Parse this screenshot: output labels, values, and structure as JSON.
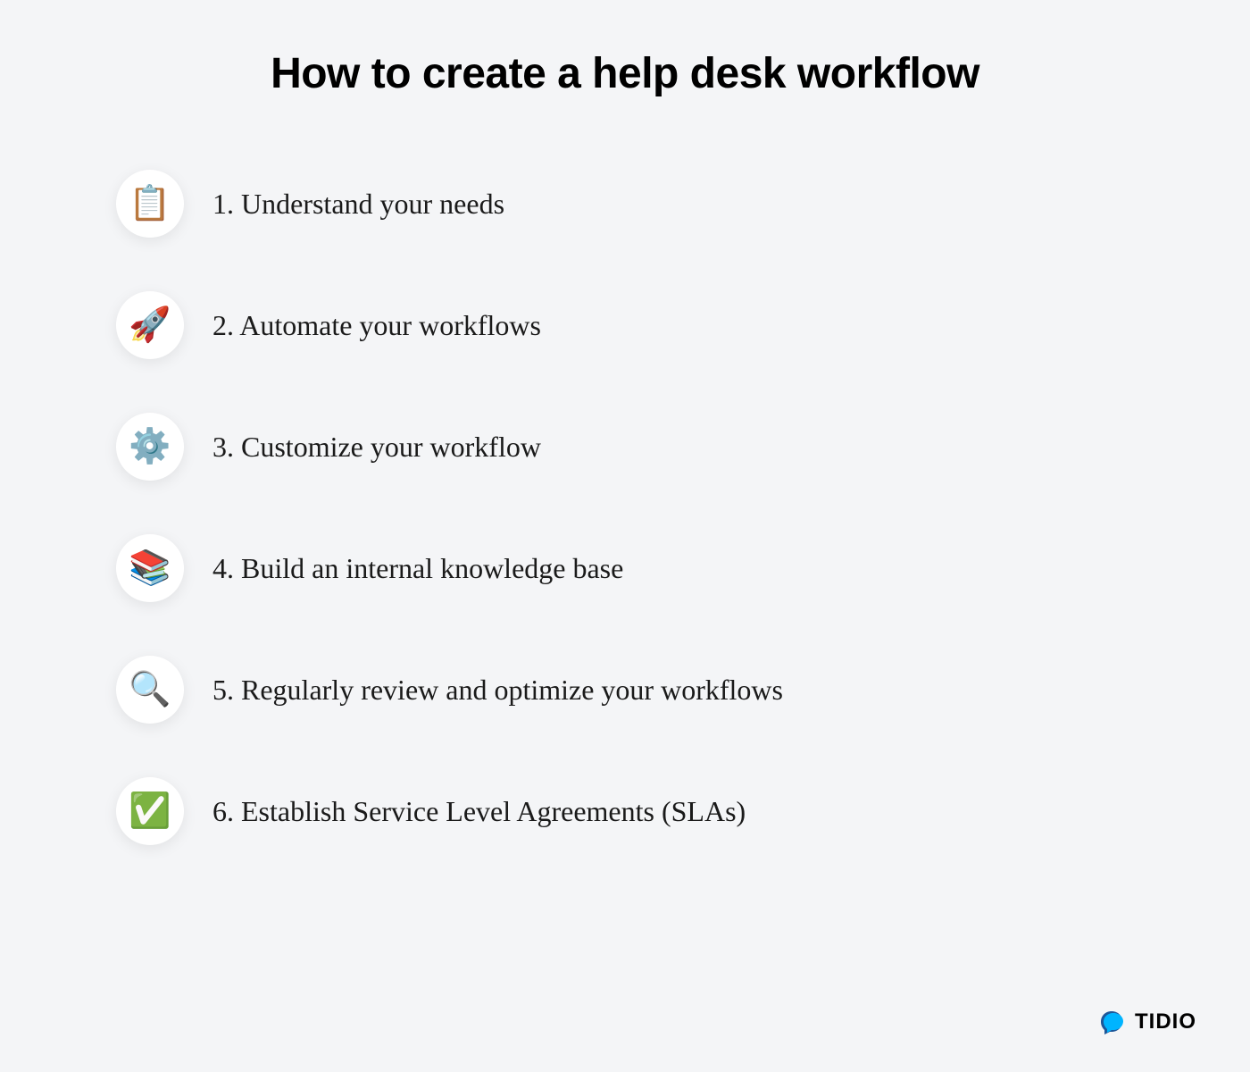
{
  "title": "How to create a help desk workflow",
  "steps": [
    {
      "icon": "📋",
      "label": "1. Understand your needs"
    },
    {
      "icon": "🚀",
      "label": "2. Automate your workflows"
    },
    {
      "icon": "⚙️",
      "label": " 3. Customize your workflow"
    },
    {
      "icon": "📚",
      "label": "4. Build an internal knowledge base"
    },
    {
      "icon": "🔍",
      "label": "5. Regularly review and optimize your workflows"
    },
    {
      "icon": "✅",
      "label": "6. Establish Service Level Agreements (SLAs)"
    }
  ],
  "brand": {
    "name": "TIDIO"
  }
}
